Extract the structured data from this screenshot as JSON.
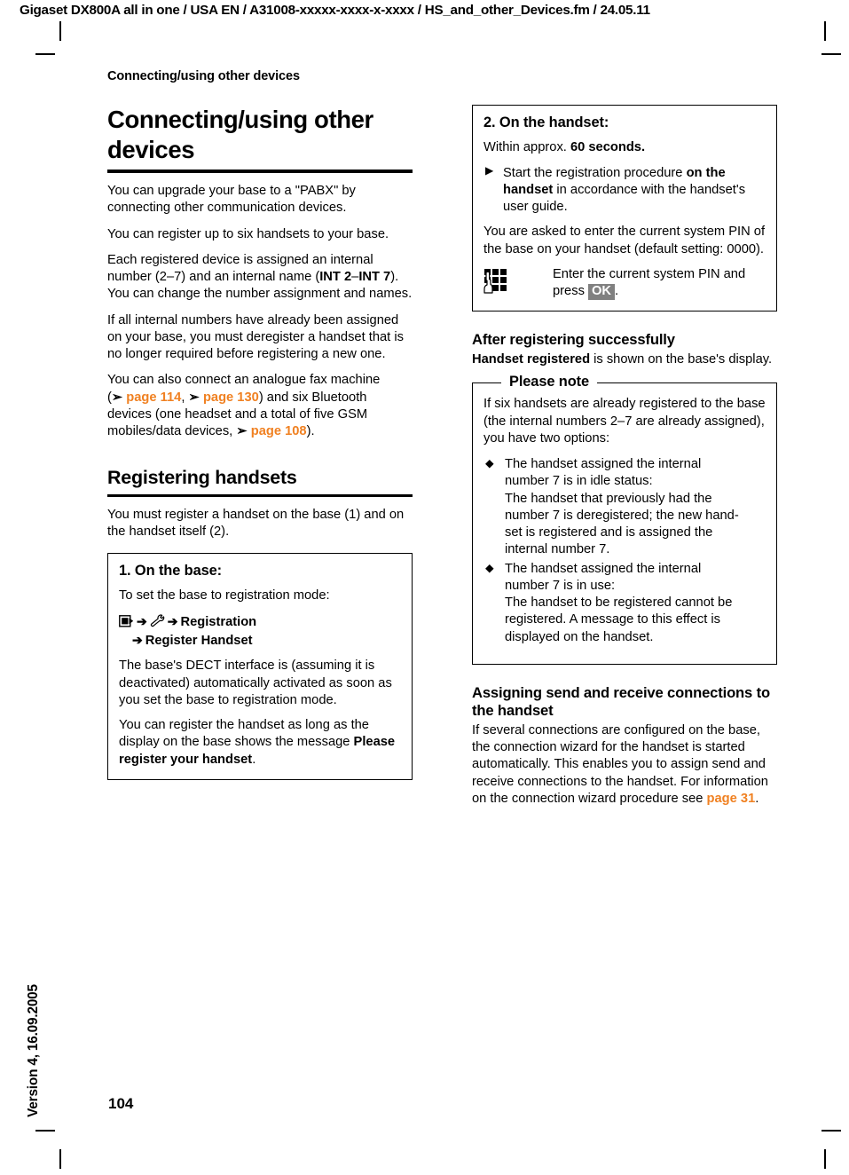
{
  "header": {
    "running_head": "Gigaset DX800A all in one / USA EN / A31008-xxxxx-xxxx-x-xxxx / HS_and_other_Devices.fm / 24.05.11",
    "breadcrumb": "Connecting/using other devices"
  },
  "footer": {
    "page_number": "104",
    "version": "Version 4, 16.09.2005"
  },
  "colors": {
    "reference_orange": "#F08122",
    "keycap_gray": "#808080",
    "text_black": "#000000"
  },
  "left_column": {
    "title": "Connecting/using other devices",
    "paragraphs": [
      "You can upgrade your base to a \"PABX\" by connecting other communication devices.",
      "You can register up to six handsets to your base."
    ],
    "para_internal_name": {
      "part1": "Each registered device is assigned an internal number (2–7) and an internal name (",
      "bold1": "INT 2",
      "dash": "–",
      "bold2": "INT 7",
      "part2": "). You can change the number assignment and names."
    },
    "para_deregister": "If all internal numbers have already been assigned on your base, you must deregister a handset that is no longer required before registering a new one.",
    "para_fax": {
      "part1": "You can also connect an analogue fax machine (",
      "ref1": "page 114",
      "comma": ",",
      "ref2": "page 130",
      "part2": ") and six Bluetooth devices (one headset and a total of five GSM mobiles/data devices,",
      "ref3": "page 108",
      "part3": ")."
    },
    "section_heading": "Registering handsets",
    "section_intro": "You must register a handset on the base (1) and on the handset itself (2).",
    "box_base": {
      "title": "1. On the base:",
      "intro": "To set the base to registration mode:",
      "menu_path": {
        "icon1": "display-with-arrow-icon",
        "sep1": "➔",
        "icon2": "wrench-settings-icon",
        "sep2": "➔",
        "item1": "Registration",
        "sep3": "➔",
        "item2": "Register Handset"
      },
      "para1": "The base's DECT interface is (assuming it is deactivated) automatically activated as soon as you set the base to registration mode.",
      "para2_part1": "You can register the handset as long as the display on the base shows the message ",
      "para2_bold": "Please register  your handset",
      "para2_part2": "."
    }
  },
  "right_column": {
    "box_handset": {
      "title": "2. On the handset:",
      "within_part1": "Within approx. ",
      "within_bold": "60 seconds.",
      "bullet1": {
        "part1": "Start the registration procedure ",
        "bold1": "on the handset",
        "part2": " in accordance with the handset's user guide."
      },
      "para_pin": "You are asked to enter the current system PIN of the base on your handset (default setting: 0000).",
      "pin_row": {
        "icon": "keypad-with-hand-icon",
        "text_part1": "Enter the current system PIN and press ",
        "keycap": "OK",
        "text_part2": "."
      }
    },
    "after_registering": {
      "heading": "After registering successfully",
      "body_bold": "Handset registered",
      "body_rest": " is shown on the base's display."
    },
    "please_note": {
      "legend": "Please note",
      "intro": "If six handsets are already registered to the base (the internal numbers 2–7 are already assigned), you have two options:",
      "bullets": [
        "The handset assigned the internal number 7 is in idle status:\nThe handset that previously had the number 7 is deregistered; the new handset is registered and is assigned the internal number 7.",
        "The handset assigned the internal number 7 is in use:\nThe handset to be registered cannot be registered. A message to this effect is displayed on the handset."
      ],
      "bullets_lines": [
        [
          "The handset assigned the internal",
          "number 7 is in idle status:",
          "The handset that previously had the",
          "number 7 is deregistered; the new hand-",
          "set is registered and is assigned the",
          "internal number 7."
        ],
        [
          "The handset assigned the internal",
          "number 7 is in use:",
          "The handset to be registered cannot be",
          "registered. A message to this effect is",
          "displayed on the handset."
        ]
      ]
    },
    "assigning": {
      "heading": "Assigning send and receive connections to the handset",
      "body_part1": "If several connections are configured on the base, the connection wizard for the handset is started automatically. This enables you to assign send and receive connections to the handset. For information on the connection wizard procedure see ",
      "ref": "page 31",
      "body_part2": "."
    }
  }
}
